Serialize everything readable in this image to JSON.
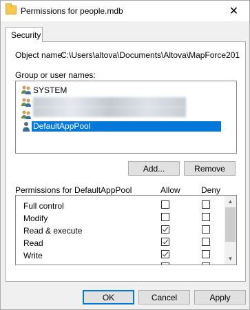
{
  "window": {
    "title": "Permissions for people.mdb",
    "close_glyph": "✕"
  },
  "tab": {
    "label": "Security"
  },
  "object": {
    "label": "Object name:",
    "value": "C:\\Users\\altova\\Documents\\Altova\\MapForce201"
  },
  "groups": {
    "label": "Group or user names:",
    "items": [
      {
        "label": "SYSTEM",
        "icon": "users-group-icon",
        "selected": false,
        "redacted": false
      },
      {
        "label": "",
        "icon": "users-group-icon",
        "selected": false,
        "redacted": true
      },
      {
        "label": "",
        "icon": "users-group-icon",
        "selected": false,
        "redacted": true
      },
      {
        "label": "DefaultAppPool",
        "icon": "user-icon",
        "selected": true,
        "redacted": false
      }
    ],
    "add_button": "Add...",
    "remove_button": "Remove"
  },
  "permissions": {
    "label": "Permissions for DefaultAppPool",
    "allow_header": "Allow",
    "deny_header": "Deny",
    "rows": [
      {
        "name": "Full control",
        "allow": false,
        "deny": false
      },
      {
        "name": "Modify",
        "allow": false,
        "deny": false
      },
      {
        "name": "Read & execute",
        "allow": true,
        "deny": false
      },
      {
        "name": "Read",
        "allow": true,
        "deny": false
      },
      {
        "name": "Write",
        "allow": true,
        "deny": false
      }
    ]
  },
  "footer": {
    "ok": "OK",
    "cancel": "Cancel",
    "apply": "Apply"
  },
  "colors": {
    "selection": "#0078d7",
    "folder": "#f5c94b"
  }
}
